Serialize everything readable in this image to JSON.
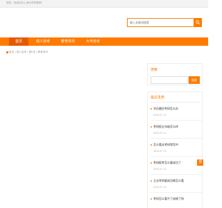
{
  "topbar": {
    "welcome": "您好，欢迎访问上海大学有限网！"
  },
  "search": {
    "placeholder": "输入关键词搜索",
    "icon": "search-icon"
  },
  "nav": {
    "items": [
      {
        "label": "首页",
        "active": true
      },
      {
        "label": "成人自考"
      },
      {
        "label": "教育资讯"
      },
      {
        "label": "大专自考"
      }
    ]
  },
  "breadcrumb": {
    "home": "首页",
    "rest": "| 成人自考 | 第2页 | 教育资讯"
  },
  "sidebar": {
    "search_title": "搜索",
    "search_button": "搜索",
    "recent_title": "最近发表",
    "posts": [
      {
        "title": "学历最好考研怎么办",
        "date": "2020-07-13"
      },
      {
        "title": "考研报五年级怎么样",
        "date": "2020-07-13"
      },
      {
        "title": "怎么看去考研常用书",
        "date": "2020-07-13"
      },
      {
        "title": "考研报考怎么看成功了",
        "date": "2020-07-13"
      },
      {
        "title": "立志考研要成功做怎么看",
        "date": "2020-07-13"
      },
      {
        "title": "考研怎么看不了成绩了呀",
        "date": ""
      }
    ]
  },
  "back_to_top": "顶",
  "colors": {
    "accent": "#ff7a00",
    "accent_dark": "#e55a00"
  }
}
